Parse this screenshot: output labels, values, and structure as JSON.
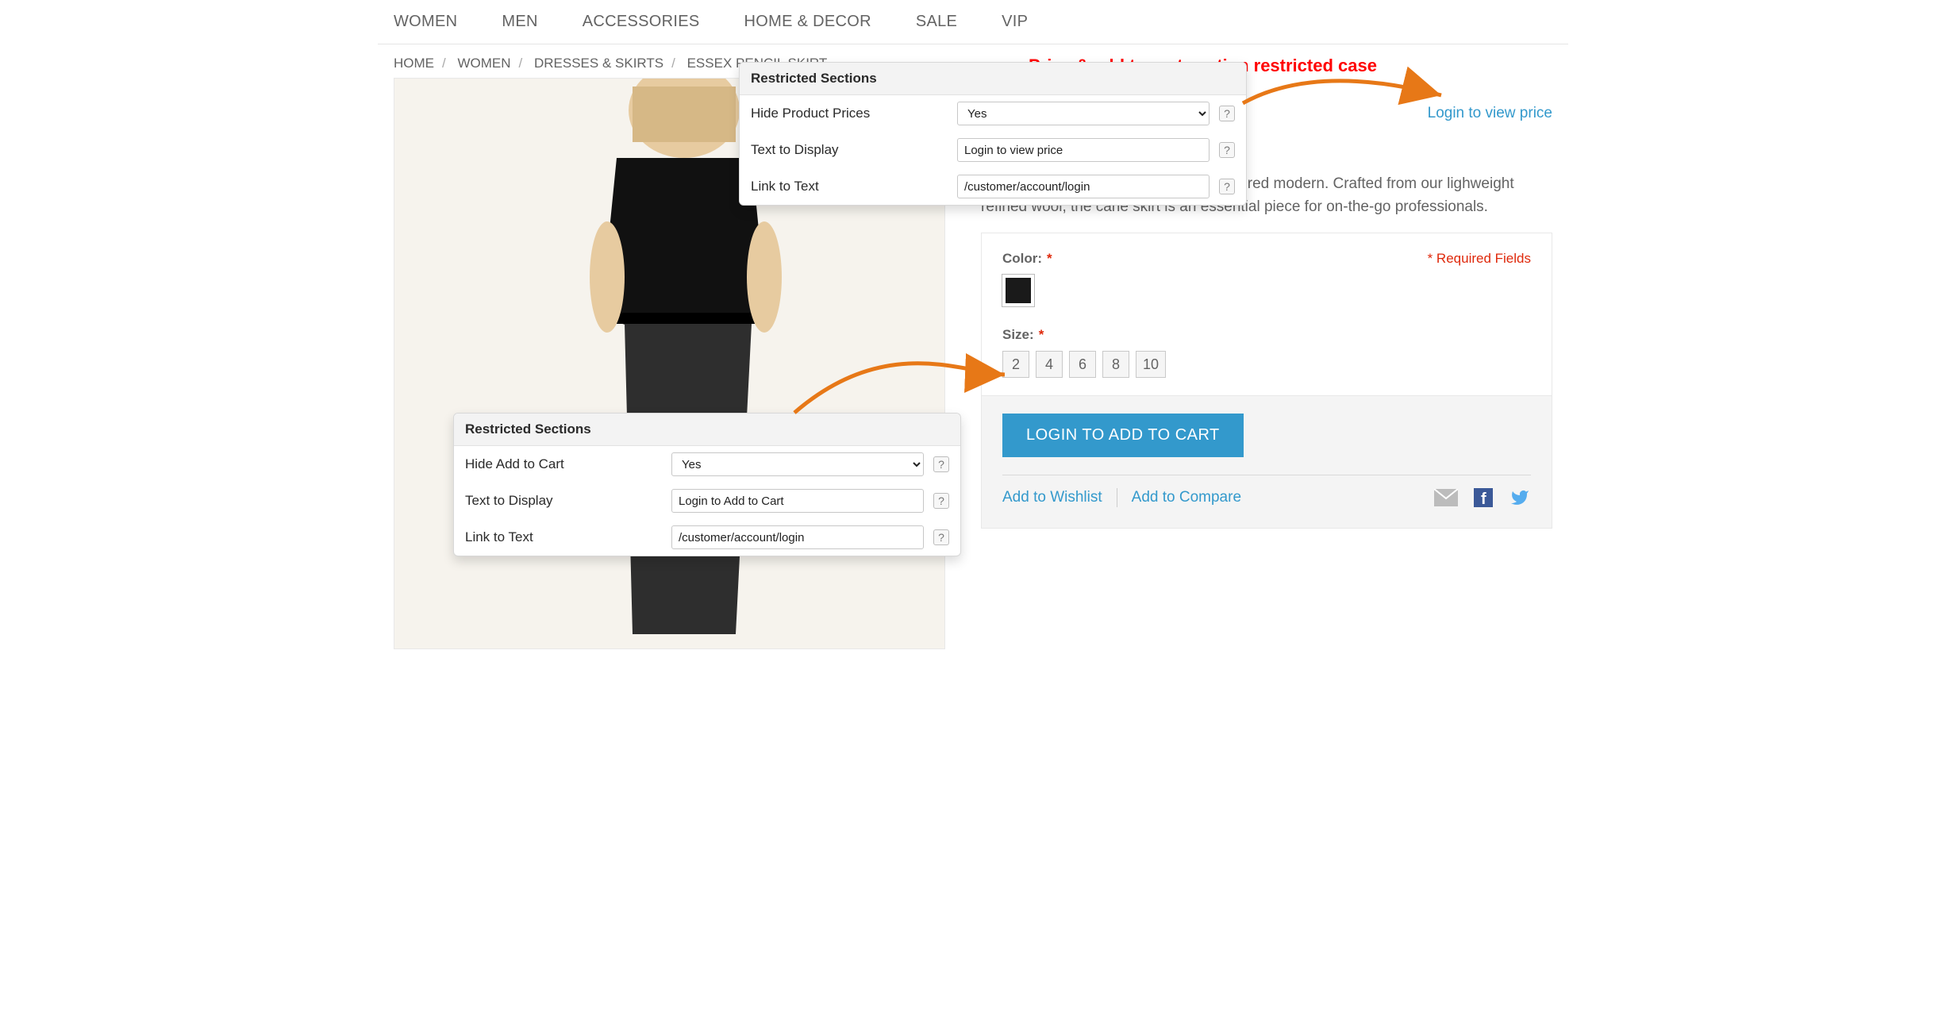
{
  "nav": {
    "items": [
      "WOMEN",
      "MEN",
      "ACCESSORIES",
      "HOME & DECOR",
      "SALE",
      "VIP"
    ]
  },
  "breadcrumb": {
    "home": "HOME",
    "women": "WOMEN",
    "category": "DRESSES & SKIRTS",
    "product": "ESSEX PENCIL SKIRT"
  },
  "annotation": "Price & add to cart section restricted case",
  "login_price_link": "Login to view price",
  "product": {
    "description": "A classic, this pencil skirt retains its tailored modern. Crafted from our lighweight refined wool, the cane skirt is an essential piece for on-the-go professionals.",
    "color_label": "Color:",
    "size_label": "Size:",
    "required_fields": "* Required Fields",
    "sizes": [
      "2",
      "4",
      "6",
      "8",
      "10"
    ],
    "colors": [
      "#1a1a1a"
    ]
  },
  "cart": {
    "button": "LOGIN TO ADD TO CART",
    "wishlist": "Add to Wishlist",
    "compare": "Add to Compare"
  },
  "panels": {
    "title": "Restricted Sections",
    "price": {
      "hide_label": "Hide Product Prices",
      "hide_value": "Yes",
      "text_label": "Text to Display",
      "text_value": "Login to view price",
      "link_label": "Link to Text",
      "link_value": "/customer/account/login"
    },
    "cart": {
      "hide_label": "Hide Add to Cart",
      "hide_value": "Yes",
      "text_label": "Text to Display",
      "text_value": "Login to Add to Cart",
      "link_label": "Link to Text",
      "link_value": "/customer/account/login"
    }
  }
}
